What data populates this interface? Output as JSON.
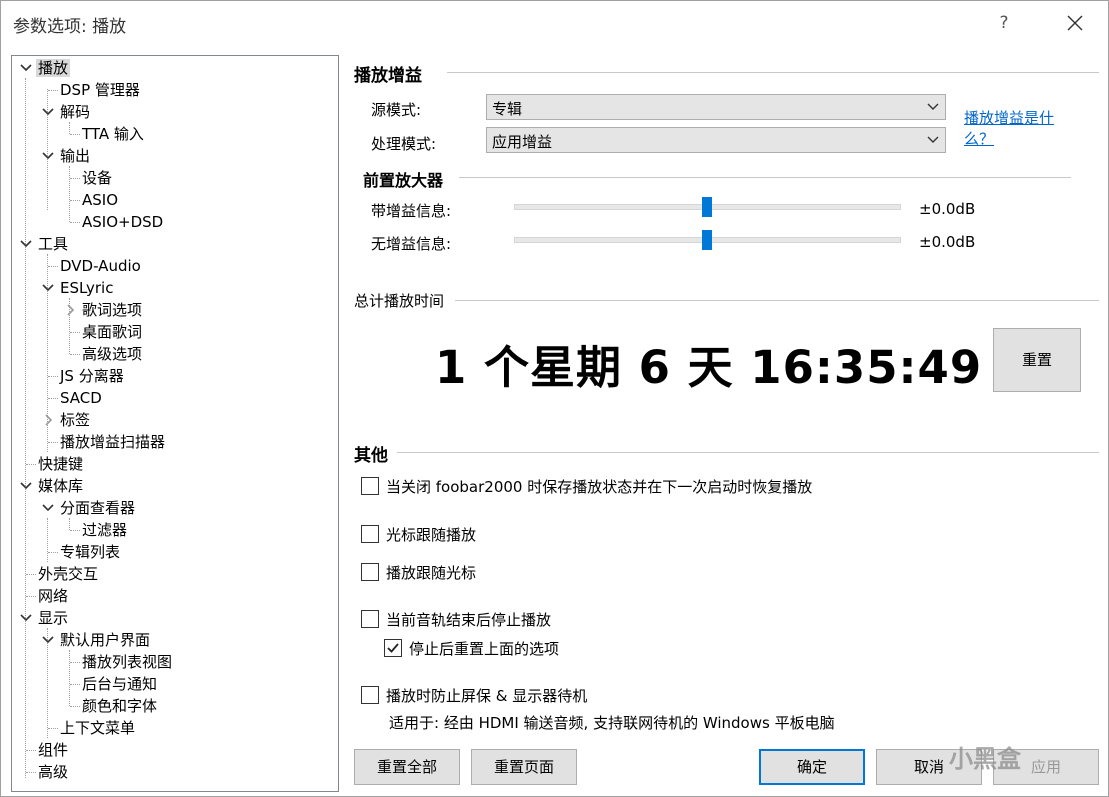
{
  "window": {
    "title": "参数选项: 播放",
    "help": "?"
  },
  "tree": [
    {
      "label": "播放",
      "selected": true
    },
    {
      "label": "DSP 管理器"
    },
    {
      "label": "解码"
    },
    {
      "label": "TTA 输入"
    },
    {
      "label": "输出"
    },
    {
      "label": "设备"
    },
    {
      "label": "ASIO"
    },
    {
      "label": "ASIO+DSD"
    },
    {
      "label": "工具"
    },
    {
      "label": "DVD-Audio"
    },
    {
      "label": "ESLyric"
    },
    {
      "label": "歌词选项"
    },
    {
      "label": "桌面歌词"
    },
    {
      "label": "高级选项"
    },
    {
      "label": "JS 分离器"
    },
    {
      "label": "SACD"
    },
    {
      "label": "标签"
    },
    {
      "label": "播放增益扫描器"
    },
    {
      "label": "快捷键"
    },
    {
      "label": "媒体库"
    },
    {
      "label": "分面查看器"
    },
    {
      "label": "过滤器"
    },
    {
      "label": "专辑列表"
    },
    {
      "label": "外壳交互"
    },
    {
      "label": "网络"
    },
    {
      "label": "显示"
    },
    {
      "label": "默认用户界面"
    },
    {
      "label": "播放列表视图"
    },
    {
      "label": "后台与通知"
    },
    {
      "label": "颜色和字体"
    },
    {
      "label": "上下文菜单"
    },
    {
      "label": "组件"
    },
    {
      "label": "高级"
    }
  ],
  "replaygain": {
    "title": "播放增益",
    "source_mode_label": "源模式:",
    "source_mode_value": "专辑",
    "processing_mode_label": "处理模式:",
    "processing_mode_value": "应用增益",
    "help_link": "播放增益是什么？"
  },
  "preamp": {
    "title": "前置放大器",
    "with_rg_label": "带增益信息:",
    "with_rg_value": "±0.0dB",
    "with_rg_level": 0.5,
    "without_rg_label": "无增益信息:",
    "without_rg_value": "±0.0dB",
    "without_rg_level": 0.5
  },
  "playtime": {
    "title": "总计播放时间",
    "value": "1 个星期 6 天 16:35:49",
    "reset_label": "重置"
  },
  "other": {
    "title": "其他",
    "options": [
      {
        "label": "当关闭 foobar2000 时保存播放状态并在下一次启动时恢复播放",
        "checked": false
      },
      {
        "label": "光标跟随播放",
        "checked": false
      },
      {
        "label": "播放跟随光标",
        "checked": false
      },
      {
        "label": "当前音轨结束后停止播放",
        "checked": false
      },
      {
        "label": "停止后重置上面的选项",
        "checked": true
      },
      {
        "label": "播放时防止屏保 & 显示器待机",
        "checked": false
      }
    ],
    "note": "适用于: 经由 HDMI 输送音频, 支持联网待机的 Windows 平板电脑"
  },
  "buttons": {
    "reset_all": "重置全部",
    "reset_page": "重置页面",
    "ok": "确定",
    "cancel": "取消",
    "apply": "应用"
  },
  "watermark": "小黑盒",
  "colors": {
    "accent": "#0078d7",
    "link": "#0066cc",
    "selection": "#d9d9d9"
  }
}
